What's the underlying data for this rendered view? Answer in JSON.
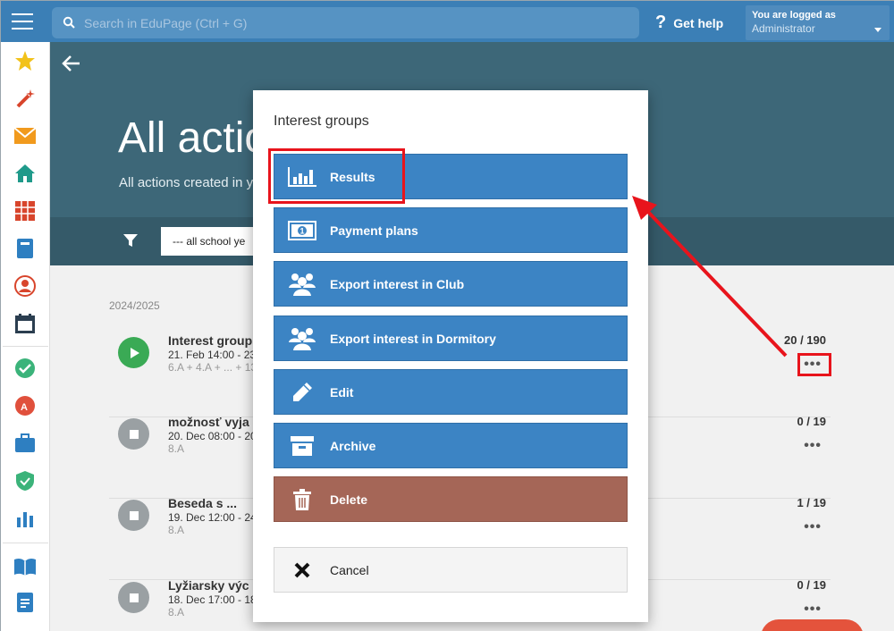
{
  "topbar": {
    "search_placeholder": "Search in EduPage (Ctrl + G)",
    "help_label": "Get help",
    "account_line1": "You are logged as",
    "account_line2": "Administrator"
  },
  "hero": {
    "title": "All actio",
    "subtitle": "All actions created in y",
    "filter_select": "--- all school ye"
  },
  "list": {
    "year": "2024/2025",
    "rows": [
      {
        "title": "Interest group",
        "meta": "21. Feb 14:00 - 23",
        "classes": "6.A + 4.A + ... + 13",
        "count": "20 / 190",
        "more": "•••",
        "status": "running"
      },
      {
        "title": "možnosť vyja",
        "meta": "20. Dec 08:00 - 20",
        "classes": "8.A",
        "count": "0 / 19",
        "more": "•••",
        "status": "stopped"
      },
      {
        "title": "Beseda s ...",
        "meta": "19. Dec 12:00 - 24",
        "classes": "8.A",
        "count": "1 / 19",
        "more": "•••",
        "status": "stopped"
      },
      {
        "title": "Lyžiarsky výc",
        "meta": "18. Dec 17:00 - 18",
        "classes": "8.A",
        "count": "0 / 19",
        "more": "•••",
        "status": "stopped"
      }
    ]
  },
  "modal": {
    "title": "Interest groups",
    "buttons": {
      "results": "Results",
      "payment_plans": "Payment plans",
      "export_club": "Export interest in Club",
      "export_dormitory": "Export interest in Dormitory",
      "edit": "Edit",
      "archive": "Archive",
      "delete": "Delete",
      "cancel": "Cancel"
    }
  },
  "colors": {
    "topbar": "#3b7fb6",
    "hero": "#3d6778",
    "button": "#3c84c4",
    "delete": "#a56657",
    "highlight": "#e8141c"
  }
}
